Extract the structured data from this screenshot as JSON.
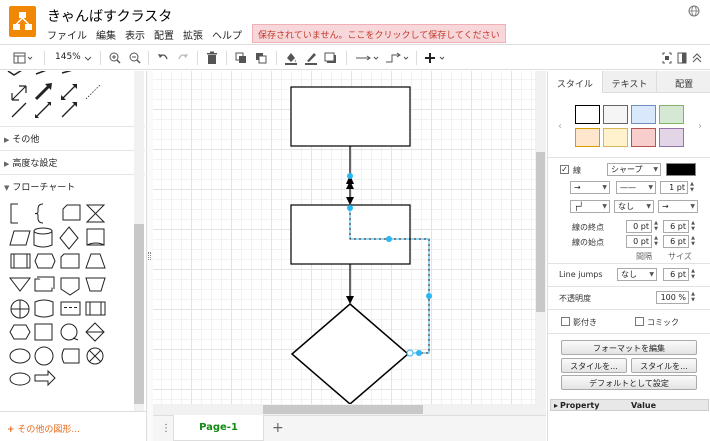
{
  "header": {
    "title": "きゃんばすクラスタ",
    "menu": [
      "ファイル",
      "編集",
      "表示",
      "配置",
      "拡張",
      "ヘルプ"
    ],
    "save_warning": "保存されていません。ここをクリックして保存してください"
  },
  "toolbar": {
    "zoom": "145%",
    "icons": [
      "page-view-icon",
      "zoom-in-icon",
      "zoom-out-icon",
      "undo-icon",
      "redo-icon",
      "delete-icon",
      "to-front-icon",
      "to-back-icon",
      "fill-color-icon",
      "line-color-icon",
      "shadow-icon",
      "connection-icon",
      "waypoints-icon",
      "insert-icon",
      "fit-icon",
      "format-panel-icon",
      "collapse-icon"
    ]
  },
  "left_panel": {
    "sections": {
      "other": "その他",
      "advanced": "高度な設定",
      "flowchart": "フローチャート"
    },
    "more_shapes": "その他の図形..."
  },
  "page_tabs": {
    "current": "Page-1"
  },
  "right_panel": {
    "tabs": [
      "スタイル",
      "テキスト",
      "配置"
    ],
    "swatch_colors": [
      {
        "fill": "#ffffff",
        "stroke": "#000000"
      },
      {
        "fill": "#f5f5f5",
        "stroke": "#666666"
      },
      {
        "fill": "#dae8fc",
        "stroke": "#6c8ebf"
      },
      {
        "fill": "#d5e8d4",
        "stroke": "#82b366"
      },
      {
        "fill": "#ffe6cc",
        "stroke": "#d79b00"
      },
      {
        "fill": "#fff2cc",
        "stroke": "#d6b656"
      },
      {
        "fill": "#f8cecc",
        "stroke": "#b85450"
      },
      {
        "fill": "#e1d5e7",
        "stroke": "#9673a6"
      }
    ],
    "line": {
      "label": "線",
      "style": "シャープ",
      "color": "#000000",
      "width": "1 pt",
      "start_label": "線の終点",
      "end_label": "線の始点",
      "end_spacing": "0 pt",
      "end_size": "6 pt",
      "start_spacing": "0 pt",
      "start_size": "6 pt",
      "spacing_label": "間隔",
      "size_label": "サイズ",
      "waypoint_value": "なし"
    },
    "line_jumps": {
      "label": "Line jumps",
      "value": "なし",
      "size": "6 pt"
    },
    "opacity": {
      "label": "不透明度",
      "value": "100 %"
    },
    "shadow_label": "影付き",
    "comic_label": "コミック",
    "buttons": {
      "edit_format": "フォーマットを編集",
      "copy_style": "スタイルを...",
      "paste_style": "スタイルを...",
      "set_default": "デフォルトとして設定"
    },
    "property_table": {
      "col1": "Property",
      "col2": "Value"
    }
  }
}
